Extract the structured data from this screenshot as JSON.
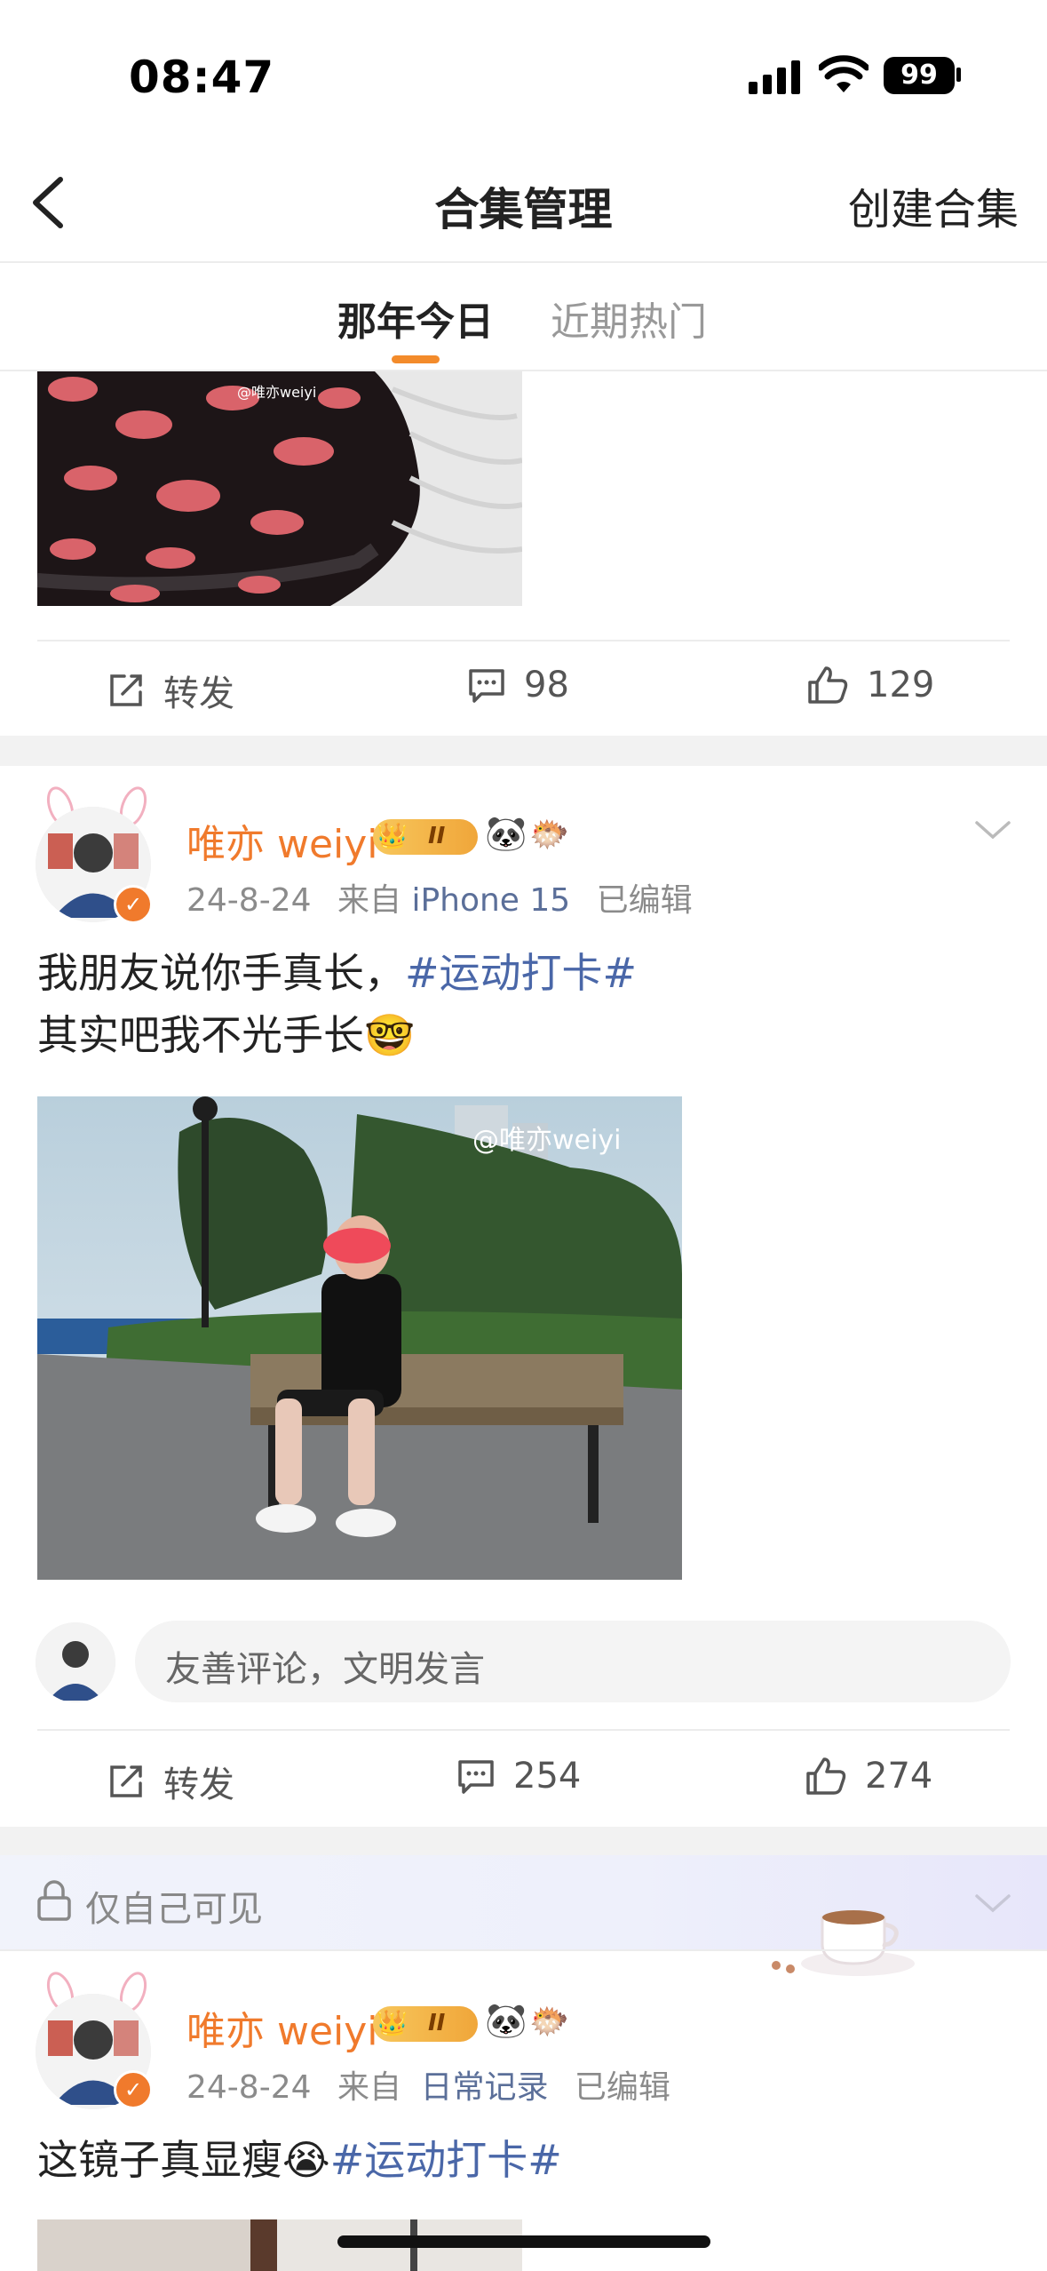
{
  "status": {
    "time": "08:47",
    "battery": "99"
  },
  "nav": {
    "title": "合集管理",
    "create": "创建合集"
  },
  "tabs": [
    {
      "label": "那年今日"
    },
    {
      "label": "近期热门"
    }
  ],
  "post_top": {
    "watermark": "@唯亦weiyi",
    "repost": "转发",
    "comments": "98",
    "likes": "129"
  },
  "post2": {
    "author": "唯亦 weiyi",
    "level": "II",
    "date": "24-8-24",
    "from_label": "来自",
    "source": "iPhone 15",
    "edited": "已编辑",
    "text_line1": "我朋友说你手真长，",
    "hashtag": "#运动打卡#",
    "text_line2": "其实吧我不光手长",
    "image_watermark": "@唯亦weiyi",
    "comment_placeholder": "友善评论，文明发言",
    "repost": "转发",
    "comments": "254",
    "likes": "274"
  },
  "post3": {
    "visibility": "仅自己可见",
    "author": "唯亦 weiyi",
    "level": "II",
    "date": "24-8-24",
    "from_label": "来自",
    "source": "日常记录",
    "edited": "已编辑",
    "text": "这镜子真显瘦",
    "hashtag": "#运动打卡#"
  },
  "colors": {
    "accent": "#f07a2c",
    "link": "#4a67a8",
    "tab_indicator": "#f38b2b"
  }
}
